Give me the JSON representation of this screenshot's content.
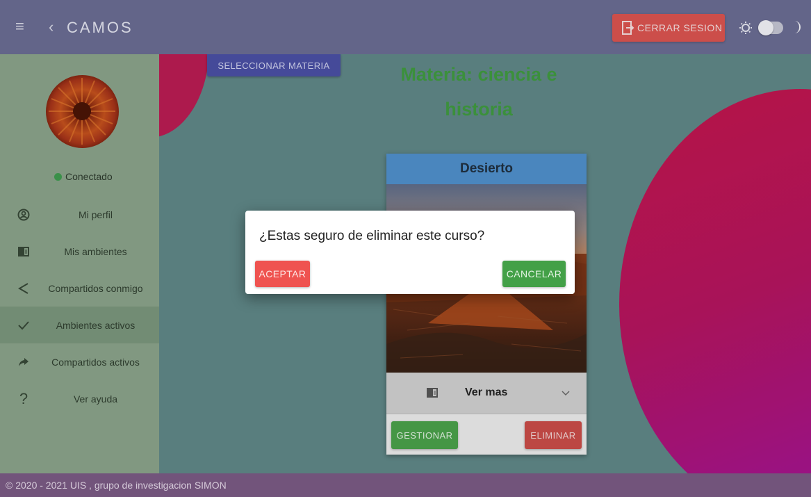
{
  "header": {
    "menu_icon": "hamburger-menu-icon",
    "back_icon": "chevron-left-icon",
    "back_glyph": "‹",
    "menu_glyph": "≡",
    "title": "CAMOS",
    "logout_label": "CERRAR SESION",
    "logout_icon": "logout-icon",
    "theme_light_icon": "sun-icon",
    "theme_dark_icon": "moon-icon"
  },
  "sidebar": {
    "avatar": "flower-avatar",
    "status": "Conectado",
    "status_color": "#3e9a4e",
    "items": [
      {
        "label": "Mi perfil",
        "icon": "account-icon",
        "active": false
      },
      {
        "label": "Mis ambientes",
        "icon": "book-icon",
        "active": false
      },
      {
        "label": "Compartidos conmigo",
        "icon": "share-icon",
        "active": false
      },
      {
        "label": "Ambientes activos",
        "icon": "check-icon",
        "active": true
      },
      {
        "label": "Compartidos activos",
        "icon": "forward-icon",
        "active": false
      },
      {
        "label": "Ver ayuda",
        "icon": "help-icon",
        "active": false
      }
    ]
  },
  "main": {
    "select_subject_label": "SELECCIONAR MATERIA",
    "subject_title": "Materia: ciencia e historia",
    "card": {
      "title": "Desierto",
      "image": "desert-volcano-image",
      "more_label": "Ver mas",
      "more_icon": "book-icon",
      "expand_icon": "chevron-down-icon",
      "manage_label": "GESTIONAR",
      "delete_label": "ELIMINAR"
    }
  },
  "dialog": {
    "message": "¿Estas seguro de eliminar este curso?",
    "accept_label": "ACEPTAR",
    "cancel_label": "CANCELAR"
  },
  "footer": {
    "text": "© 2020 - 2021 UIS , grupo de investigacion SIMON"
  },
  "colors": {
    "header_bg": "#6a6c92",
    "sidebar_bg": "#8aa28a",
    "main_bg": "#5f8686",
    "footer_bg": "#7a5a83",
    "logout_bg": "#d9534f",
    "select_bg": "#4a4fa3",
    "subject_title": "#3f9a3f",
    "card_header": "#4f8fca",
    "accept_bg": "#ef5350",
    "cancel_bg": "#43a047"
  }
}
